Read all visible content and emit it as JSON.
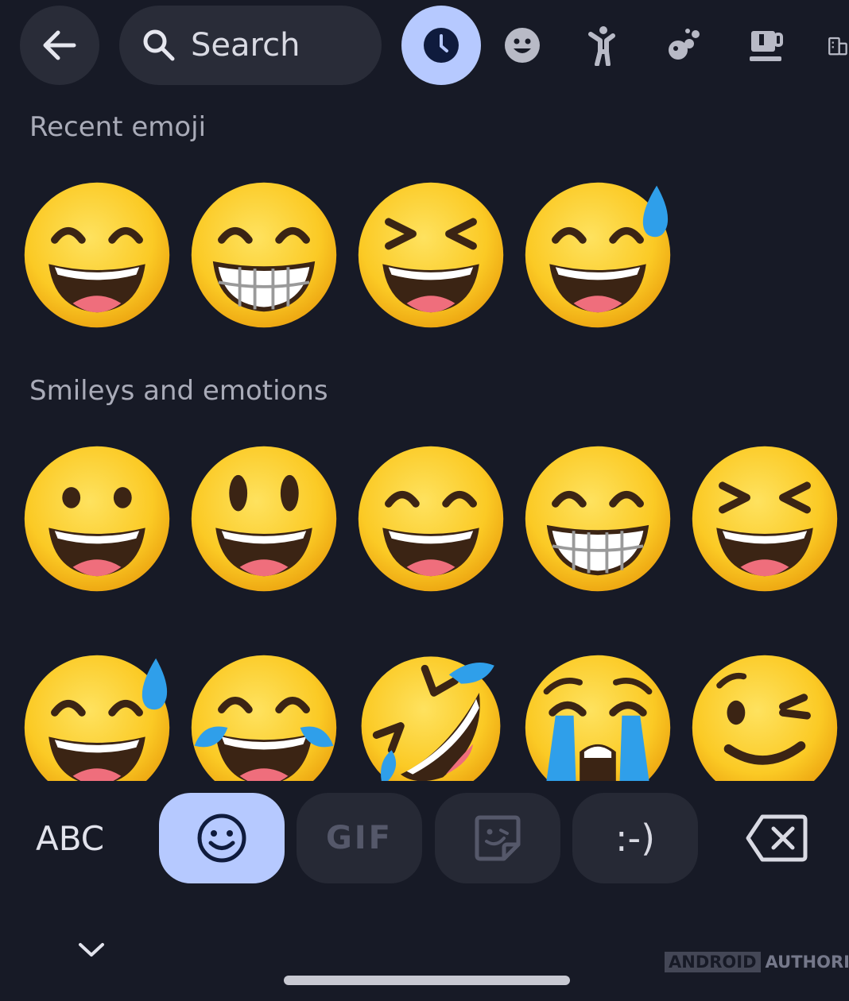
{
  "search": {
    "label": "Search"
  },
  "categories": [
    {
      "icon": "clock-icon",
      "active": true
    },
    {
      "icon": "smiley-icon",
      "active": false
    },
    {
      "icon": "person-icon",
      "active": false
    },
    {
      "icon": "animals-icon",
      "active": false
    },
    {
      "icon": "food-icon",
      "active": false
    },
    {
      "icon": "buildings-icon",
      "active": false
    }
  ],
  "sections": {
    "recent": "Recent emoji",
    "smileys": "Smileys and emotions"
  },
  "recent_emoji": [
    "grinning-smiling-eyes",
    "beaming-grin",
    "squinting-grin",
    "grinning-sweat"
  ],
  "smileys_row1": [
    "grinning-face",
    "grinning-big-eyes",
    "grinning-smiling-eyes",
    "beaming-grin",
    "squinting-grin"
  ],
  "smileys_row2": [
    "grinning-sweat",
    "tears-of-joy",
    "rofl",
    "loudly-crying",
    "winking-face"
  ],
  "bottom_bar": {
    "abc_label": "ABC",
    "gif_label": "GIF",
    "emoticon_label": ":-)"
  },
  "watermark": {
    "part1": "ANDROID",
    "part2": "AUTHORITY"
  },
  "colors": {
    "background": "#171a26",
    "pill": "#292c38",
    "accent": "#b6c9ff",
    "emoji_yellow": "#fbcb2c"
  }
}
